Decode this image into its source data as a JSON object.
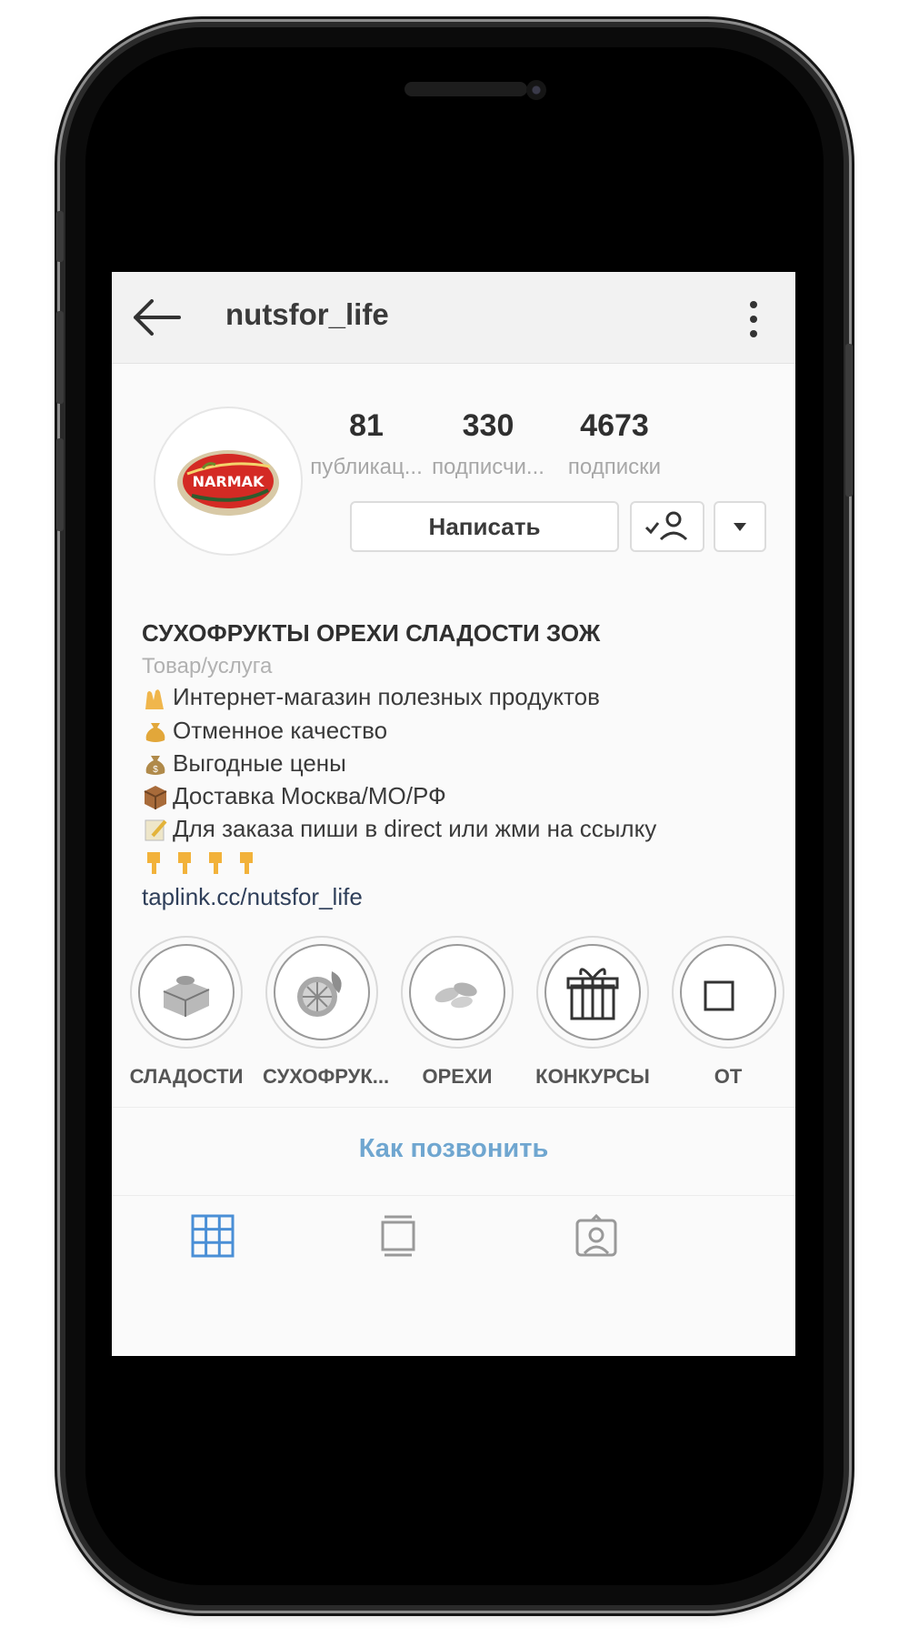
{
  "header": {
    "username": "nutsfor_life"
  },
  "profile": {
    "avatar_text": "NARMAK",
    "stats": [
      {
        "value": "81",
        "label": "публикац..."
      },
      {
        "value": "330",
        "label": "подписчи..."
      },
      {
        "value": "4673",
        "label": "подписки"
      }
    ],
    "message_button": "Написать"
  },
  "bio": {
    "name": "СУХОФРУКТЫ ОРЕХИ СЛАДОСТИ ЗОЖ",
    "category": "Товар/услуга",
    "lines": [
      {
        "icon": "raised-hands-icon",
        "text": "Интернет-магазин полезных продуктов"
      },
      {
        "icon": "money-bag-icon",
        "text": "Отменное качество"
      },
      {
        "icon": "money-bag-icon",
        "text": "Выгодные цены"
      },
      {
        "icon": "package-icon",
        "text": "Доставка Москва/МО/РФ"
      },
      {
        "icon": "memo-icon",
        "text": "Для заказа пиши в direct или жми на ссылку"
      }
    ],
    "pointing_emojis": [
      "pointing-down-icon",
      "pointing-down-icon",
      "pointing-down-icon",
      "pointing-down-icon"
    ],
    "link": "taplink.cc/nutsfor_life"
  },
  "highlights": [
    {
      "label": "СЛАДОСТИ",
      "icon": "baklava-icon"
    },
    {
      "label": "СУХОФРУК...",
      "icon": "dried-fruit-icon"
    },
    {
      "label": "ОРЕХИ",
      "icon": "nuts-icon"
    },
    {
      "label": "КОНКУРСЫ",
      "icon": "gift-icon"
    },
    {
      "label": "ОТ",
      "icon": "box-icon"
    }
  ],
  "action": {
    "call_label": "Как позвонить"
  },
  "tabs": [
    {
      "icon": "grid-icon",
      "active": true
    },
    {
      "icon": "feed-icon",
      "active": false
    },
    {
      "icon": "tagged-icon",
      "active": false
    }
  ],
  "colors": {
    "accent_blue": "#6fa6d0",
    "active_tab": "#4a8fd6",
    "text_dark": "#2f2f2f",
    "text_muted": "#a7a7a7"
  }
}
